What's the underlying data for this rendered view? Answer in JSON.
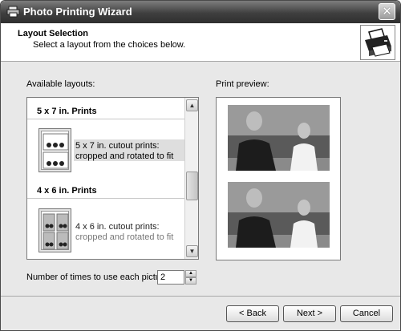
{
  "window": {
    "title": "Photo Printing Wizard",
    "close_glyph": "✕"
  },
  "header": {
    "title": "Layout Selection",
    "subtitle": "Select a layout from the choices below."
  },
  "labels": {
    "available_layouts": "Available layouts:",
    "print_preview": "Print preview:",
    "times_to_use": "Number of times to use each picture:"
  },
  "layouts": {
    "sections": [
      {
        "heading": "5 x 7 in. Prints",
        "item_line1": "5 x 7 in. cutout prints:",
        "item_line2": "cropped and rotated to fit",
        "selected": true
      },
      {
        "heading": "4 x 6 in. Prints",
        "item_line1": "4 x 6 in. cutout prints:",
        "item_line2": "cropped and rotated to fit",
        "selected": false
      }
    ]
  },
  "copies": {
    "value": "2"
  },
  "buttons": {
    "back": "< Back",
    "next": "Next >",
    "cancel": "Cancel"
  },
  "icons": {
    "title": "printer-icon",
    "header": "printer-wizard-icon",
    "scroll_up": "arrow-up-icon",
    "scroll_down": "arrow-down-icon"
  }
}
